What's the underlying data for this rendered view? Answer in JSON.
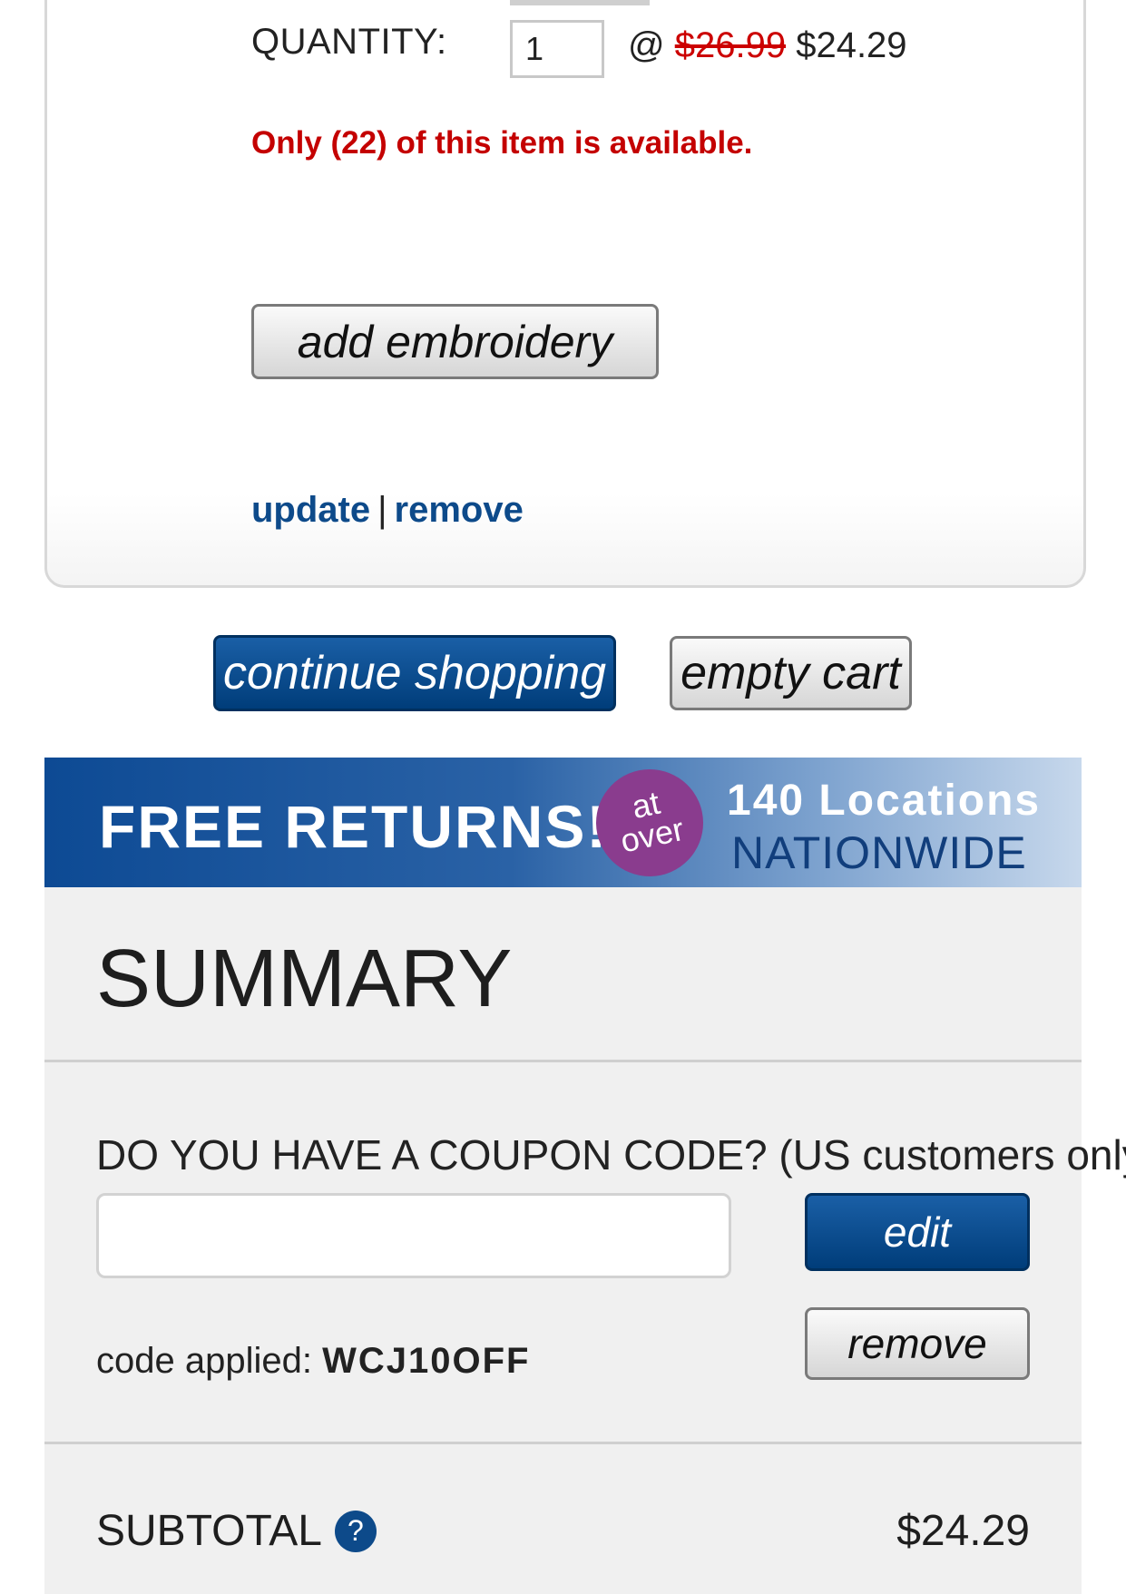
{
  "item": {
    "quantity_label": "QUANTITY:",
    "quantity_value": "1",
    "at_symbol": "@",
    "original_price": "$26.99",
    "sale_price": "$24.29",
    "availability": "Only (22) of this item is available.",
    "embroidery_label": "add embroidery",
    "update_label": "update",
    "link_separator": "|",
    "remove_label": "remove"
  },
  "cart_actions": {
    "continue_label": "continue shopping",
    "empty_label": "empty cart"
  },
  "banner": {
    "free_returns": "FREE RETURNS!",
    "at": "at",
    "over": "over",
    "locations": "140 Locations",
    "nationwide": "NATIONWIDE"
  },
  "summary": {
    "title": "SUMMARY",
    "coupon_prompt": "DO YOU HAVE A COUPON CODE? (US customers only)",
    "coupon_value": "",
    "edit_label": "edit",
    "remove_label": "remove",
    "code_applied_label": "code applied:",
    "code_applied_value": "WCJ10OFF",
    "subtotal_label": "SUBTOTAL",
    "help_symbol": "?",
    "subtotal_value": "$24.29"
  },
  "colors": {
    "brand_blue": "#0d4a8a",
    "alert_red": "#c40000",
    "banner_purple": "#8a3c8e"
  },
  "icons": {
    "help": "question-circle-icon"
  }
}
